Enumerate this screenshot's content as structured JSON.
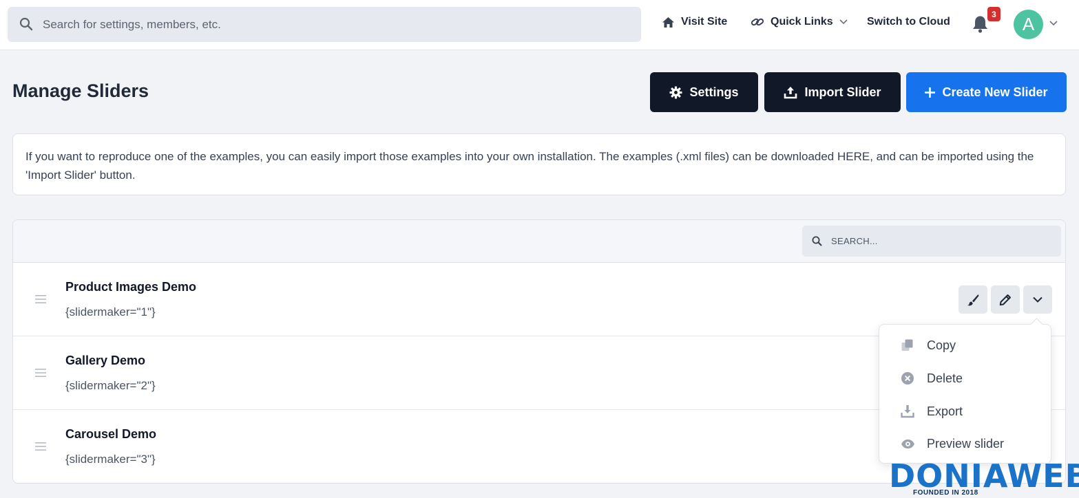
{
  "topbar": {
    "search_placeholder": "Search for settings, members, etc.",
    "visit_site": "Visit Site",
    "quick_links": "Quick Links",
    "switch_to_cloud": "Switch to Cloud",
    "notification_count": "3",
    "avatar_initial": "A"
  },
  "header": {
    "title": "Manage Sliders",
    "settings_label": "Settings",
    "import_label": "Import Slider",
    "create_label": "Create New Slider"
  },
  "info": {
    "text": "If you want to reproduce one of the examples, you can easily import those examples into your own installation. The examples (.xml files) can be downloaded HERE, and can be imported using the 'Import Slider' button."
  },
  "panel": {
    "search_placeholder": "SEARCH..."
  },
  "sliders": [
    {
      "title": "Product Images Demo",
      "code": "{slidermaker=\"1\"}"
    },
    {
      "title": "Gallery Demo",
      "code": "{slidermaker=\"2\"}"
    },
    {
      "title": "Carousel Demo",
      "code": "{slidermaker=\"3\"}"
    }
  ],
  "dropdown": {
    "items": [
      {
        "label": "Copy",
        "icon": "copy-icon"
      },
      {
        "label": "Delete",
        "icon": "delete-circle-icon"
      },
      {
        "label": "Export",
        "icon": "download-icon"
      },
      {
        "label": "Preview slider",
        "icon": "eye-icon"
      }
    ]
  },
  "watermark": {
    "logo_text": "DONIAWEB",
    "tagline": "FOUNDED IN 2018"
  },
  "colors": {
    "accent_blue": "#1673ed",
    "dark_button": "#111827",
    "avatar": "#4ec3a2",
    "badge": "#d32f2f"
  }
}
